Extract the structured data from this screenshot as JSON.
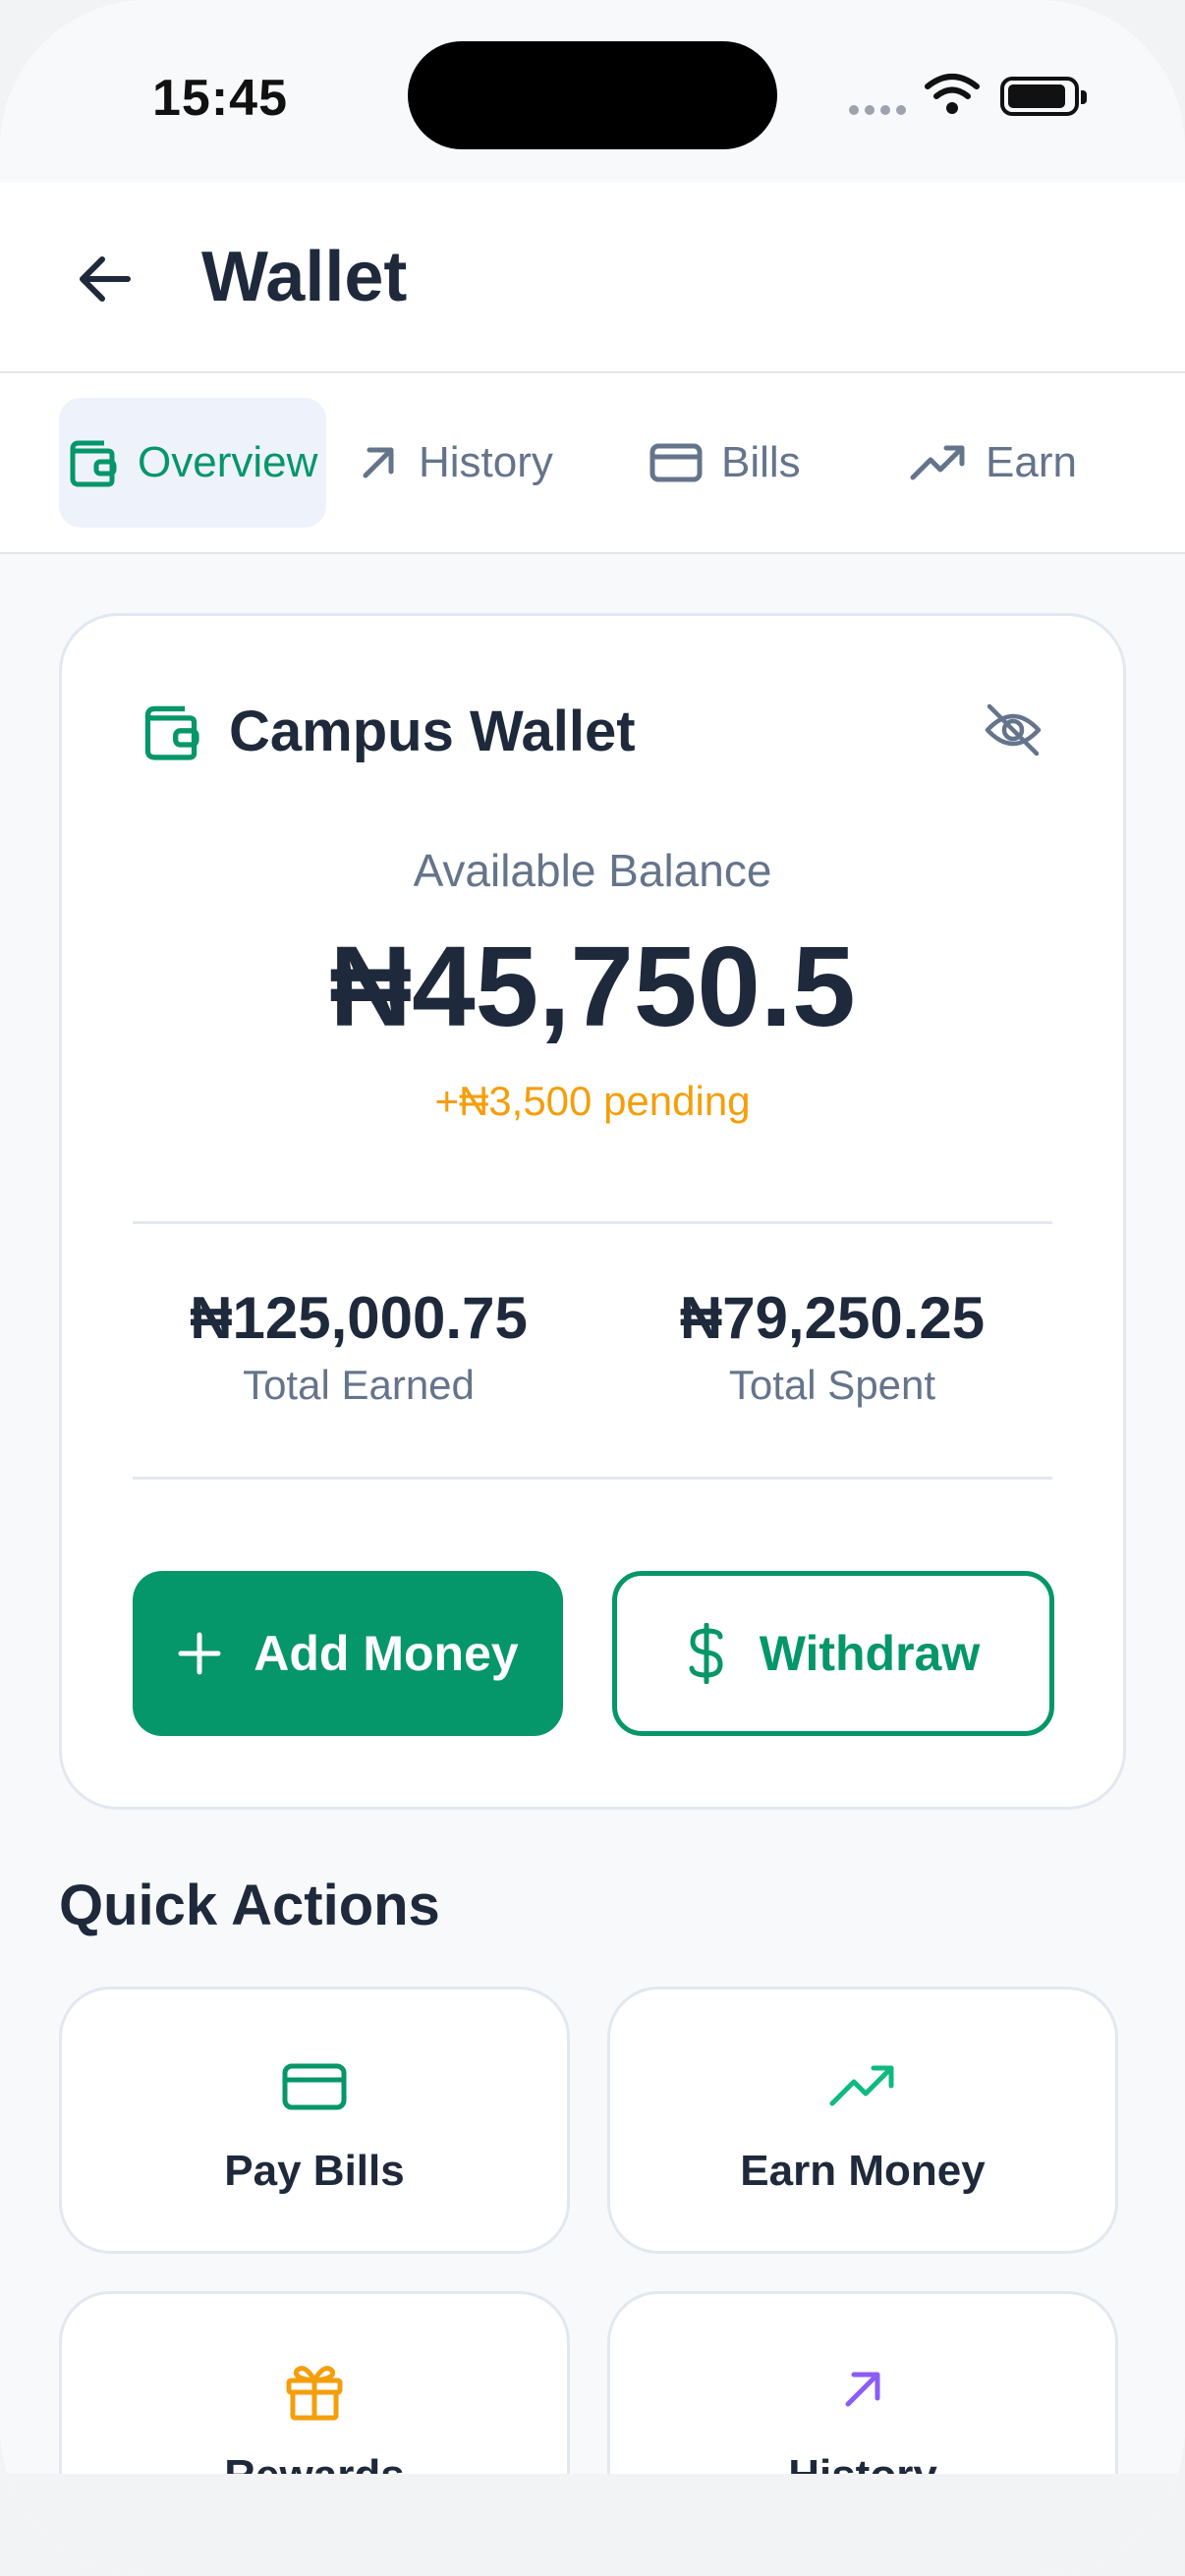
{
  "status_bar": {
    "time": "15:45"
  },
  "header": {
    "title": "Wallet"
  },
  "tabs": [
    {
      "label": "Overview",
      "icon": "wallet-icon",
      "active": true
    },
    {
      "label": "History",
      "icon": "arrow-up-right-icon",
      "active": false
    },
    {
      "label": "Bills",
      "icon": "credit-card-icon",
      "active": false
    },
    {
      "label": "Earn",
      "icon": "trending-up-icon",
      "active": false
    }
  ],
  "wallet": {
    "title": "Campus Wallet",
    "available_label": "Available Balance",
    "balance": "₦45,750.5",
    "pending": "+₦3,500 pending",
    "total_earned_value": "₦125,000.75",
    "total_earned_label": "Total Earned",
    "total_spent_value": "₦79,250.25",
    "total_spent_label": "Total Spent",
    "add_money_label": "Add Money",
    "withdraw_label": "Withdraw"
  },
  "quick_actions": {
    "title": "Quick Actions",
    "items": [
      {
        "label": "Pay Bills",
        "icon": "credit-card-icon",
        "color": "#059669"
      },
      {
        "label": "Earn Money",
        "icon": "trending-up-icon",
        "color": "#10b981"
      },
      {
        "label": "Rewards",
        "icon": "gift-icon",
        "color": "#f59e0b"
      },
      {
        "label": "History",
        "icon": "arrow-up-right-icon",
        "color": "#8b5cf6"
      }
    ]
  },
  "colors": {
    "primary": "#059669",
    "pending": "#f59e0b",
    "text": "#1e293b",
    "muted": "#64748b"
  }
}
